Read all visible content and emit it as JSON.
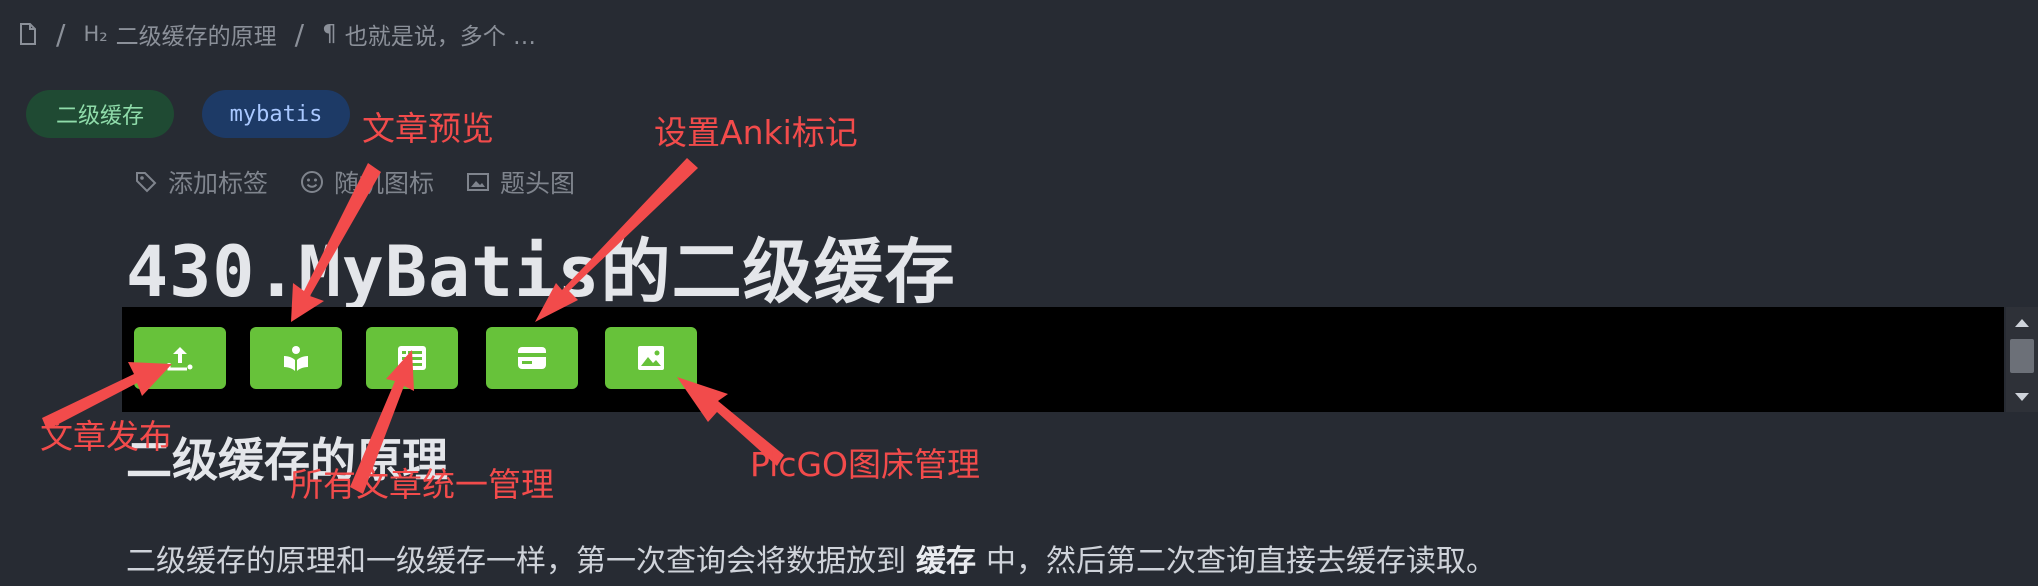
{
  "breadcrumb": {
    "h2_marker": "H₂",
    "section": "二级缓存的原理",
    "paragraph": "也就是说，多个 …"
  },
  "tags": [
    "二级缓存",
    "mybatis"
  ],
  "meta_actions": {
    "add_tag": "添加标签",
    "random_icon": "随机图标",
    "header_image": "题头图"
  },
  "article": {
    "title": "430.MyBatis的二级缓存",
    "heading": "二级缓存的原理",
    "paragraph_before": "二级缓存的原理和一级缓存一样，第一次查询会将数据放到",
    "paragraph_bold": "缓存",
    "paragraph_after": "中，然后第二次查询直接去缓存读取。"
  },
  "plugin_buttons": [
    {
      "name": "publish",
      "icon": "upload-icon"
    },
    {
      "name": "preview",
      "icon": "reader-icon"
    },
    {
      "name": "manage",
      "icon": "list-icon"
    },
    {
      "name": "anki",
      "icon": "card-icon"
    },
    {
      "name": "picgo",
      "icon": "image-icon"
    }
  ],
  "annotations": {
    "preview": "文章预览",
    "anki": "设置Anki标记",
    "publish": "文章发布",
    "manage": "所有文章统一管理",
    "picgo": "PicGO图床管理"
  },
  "colors": {
    "background": "#272b33",
    "button_green": "#67c23a",
    "annotation_red": "#f24b4b",
    "plugin_bar": "#000000"
  }
}
